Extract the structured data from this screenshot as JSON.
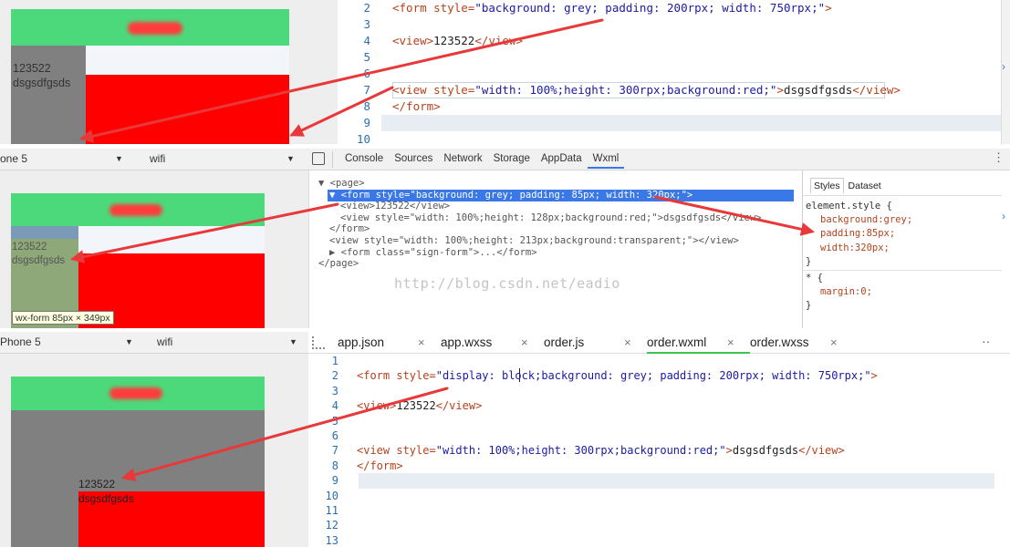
{
  "section1": {
    "phone": {
      "text1": "123522",
      "text2": "dsgsdfgsds"
    },
    "code": [
      {
        "no": "2",
        "parts": [
          [
            "tag",
            "<form "
          ],
          [
            "attr",
            "style="
          ],
          [
            "str",
            "\"background: grey; padding: 200rpx; width: 750rpx;\""
          ],
          [
            "tag",
            ">"
          ]
        ]
      },
      {
        "no": "3",
        "parts": []
      },
      {
        "no": "4",
        "parts": [
          [
            "tag",
            "<view>"
          ],
          [
            "txt",
            "123522"
          ],
          [
            "tag",
            "</view>"
          ]
        ]
      },
      {
        "no": "5",
        "parts": []
      },
      {
        "no": "6",
        "parts": []
      },
      {
        "no": "7",
        "parts": [
          [
            "tag",
            "<view "
          ],
          [
            "attr",
            "style="
          ],
          [
            "str",
            "\"width: 100%;height: 300rpx;background:red;\""
          ],
          [
            "tag",
            ">"
          ],
          [
            "txt",
            "dsgsdfgsds"
          ],
          [
            "tag",
            "</view>"
          ]
        ]
      },
      {
        "no": "8",
        "parts": [
          [
            "tag",
            "</form>"
          ]
        ]
      },
      {
        "no": "9",
        "parts": []
      },
      {
        "no": "10",
        "parts": []
      }
    ]
  },
  "devbar": {
    "device": "one 5",
    "network": "wifi",
    "tabs": [
      "Console",
      "Sources",
      "Network",
      "Storage",
      "AppData",
      "Wxml"
    ],
    "active_tab": "Wxml"
  },
  "wxml_tree": [
    {
      "indent": 0,
      "text": "▼ <page>"
    },
    {
      "indent": 1,
      "text": "▼ <form  style=\"background: grey; padding: 85px; width: 320px;\">",
      "selected": true
    },
    {
      "indent": 2,
      "text": "<view>123522</view>"
    },
    {
      "indent": 2,
      "text": "<view  style=\"width: 100%;height: 128px;background:red;\">dsgsdfgsds</view>"
    },
    {
      "indent": 1,
      "text": "</form>"
    },
    {
      "indent": 1,
      "text": "<view  style=\"width: 100%;height: 213px;background:transparent;\"></view>"
    },
    {
      "indent": 1,
      "text": "▶ <form  class=\"sign-form\">...</form>"
    },
    {
      "indent": 0,
      "text": "</page>"
    }
  ],
  "styles": {
    "tabs": [
      "Styles",
      "Dataset"
    ],
    "selector1": "element.style {",
    "props1": [
      "background:grey;",
      "padding:85px;",
      "width:320px;"
    ],
    "close": "}",
    "selector2": "* {",
    "props2": [
      "margin:0;"
    ]
  },
  "watermark": "http://blog.csdn.net/eadio",
  "section2": {
    "phone": {
      "text1": "123522",
      "text2": "dsgsdfgsds"
    },
    "tooltip": "wx-form 85px × 349px"
  },
  "editor": {
    "device": "Phone 5",
    "network": "wifi",
    "files": [
      "app.json",
      "app.wxss",
      "order.js",
      "order.wxml",
      "order.wxss"
    ],
    "active_file": "order.wxml",
    "lines": [
      {
        "no": "1",
        "parts": []
      },
      {
        "no": "2",
        "parts": [
          [
            "tag",
            "<form "
          ],
          [
            "attr",
            "style="
          ],
          [
            "str",
            "\"display: block;background: grey; padding: 200rpx; width: 750rpx;\""
          ],
          [
            "tag",
            ">"
          ]
        ]
      },
      {
        "no": "3",
        "parts": []
      },
      {
        "no": "4",
        "parts": [
          [
            "tag",
            "<view>"
          ],
          [
            "txt",
            "123522"
          ],
          [
            "tag",
            "</view>"
          ]
        ]
      },
      {
        "no": "5",
        "parts": []
      },
      {
        "no": "6",
        "parts": []
      },
      {
        "no": "7",
        "parts": [
          [
            "tag",
            "<view "
          ],
          [
            "attr",
            "style="
          ],
          [
            "str",
            "\"width: 100%;height: 300rpx;background:red;\""
          ],
          [
            "tag",
            ">"
          ],
          [
            "txt",
            "dsgsdfgsds"
          ],
          [
            "tag",
            "</view>"
          ]
        ]
      },
      {
        "no": "8",
        "parts": [
          [
            "tag",
            "</form>"
          ]
        ]
      },
      {
        "no": "9",
        "parts": []
      },
      {
        "no": "10",
        "parts": []
      },
      {
        "no": "11",
        "parts": []
      },
      {
        "no": "12",
        "parts": []
      },
      {
        "no": "13",
        "parts": []
      }
    ]
  },
  "section3": {
    "phone": {
      "text1": "123522",
      "text2": "dsgsdfgsds"
    }
  },
  "colors": {
    "header_green": "#4cd97b",
    "grey": "#808080",
    "red": "#ff0000",
    "arrow": "#e8383a",
    "selection": "#3b78e7"
  }
}
